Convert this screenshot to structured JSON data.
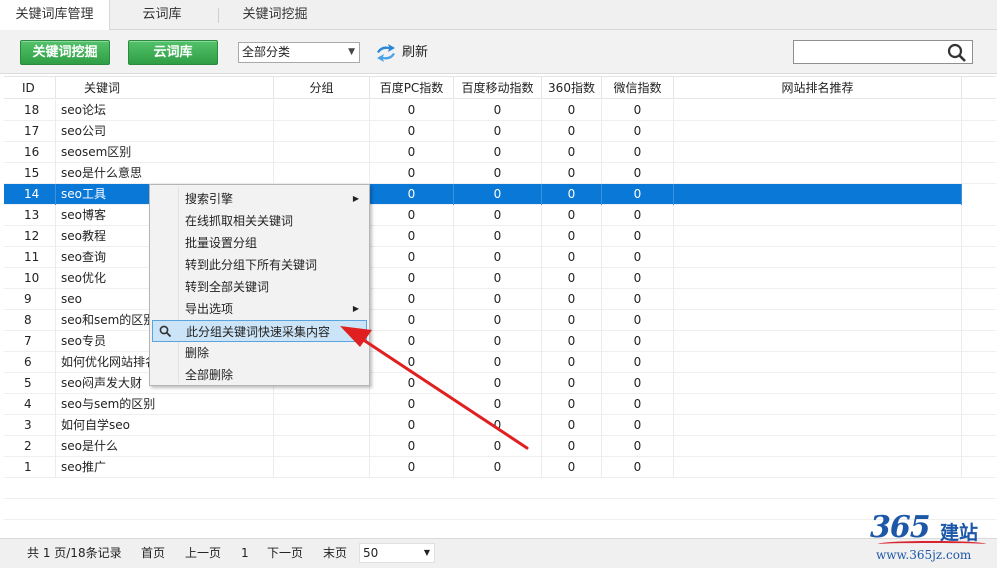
{
  "tabs": [
    {
      "label": "关键词库管理"
    },
    {
      "label": "云词库"
    },
    {
      "label": "关键词挖掘"
    }
  ],
  "toolbar": {
    "mine_button": "关键词挖掘",
    "cloud_button": "云词库",
    "category_select": "全部分类",
    "refresh_label": "刷新",
    "search_value": ""
  },
  "columns": {
    "id": "ID",
    "keyword": "关键词",
    "group": "分组",
    "baidu_pc": "百度PC指数",
    "baidu_mobile": "百度移动指数",
    "s360": "360指数",
    "wechat": "微信指数",
    "rank": "网站排名推荐"
  },
  "rows": [
    {
      "id": "18",
      "keyword": "seo论坛",
      "pc": "0",
      "mobile": "0",
      "s360": "0",
      "wechat": "0"
    },
    {
      "id": "17",
      "keyword": "seo公司",
      "pc": "0",
      "mobile": "0",
      "s360": "0",
      "wechat": "0"
    },
    {
      "id": "16",
      "keyword": "seosem区别",
      "pc": "0",
      "mobile": "0",
      "s360": "0",
      "wechat": "0"
    },
    {
      "id": "15",
      "keyword": "seo是什么意思",
      "pc": "0",
      "mobile": "0",
      "s360": "0",
      "wechat": "0"
    },
    {
      "id": "14",
      "keyword": "seo工具",
      "pc": "0",
      "mobile": "0",
      "s360": "0",
      "wechat": "0"
    },
    {
      "id": "13",
      "keyword": "seo博客",
      "pc": "0",
      "mobile": "0",
      "s360": "0",
      "wechat": "0"
    },
    {
      "id": "12",
      "keyword": "seo教程",
      "pc": "0",
      "mobile": "0",
      "s360": "0",
      "wechat": "0"
    },
    {
      "id": "11",
      "keyword": "seo查询",
      "pc": "0",
      "mobile": "0",
      "s360": "0",
      "wechat": "0"
    },
    {
      "id": "10",
      "keyword": "seo优化",
      "pc": "0",
      "mobile": "0",
      "s360": "0",
      "wechat": "0"
    },
    {
      "id": "9",
      "keyword": "seo",
      "pc": "0",
      "mobile": "0",
      "s360": "0",
      "wechat": "0"
    },
    {
      "id": "8",
      "keyword": "seo和sem的区别",
      "pc": "0",
      "mobile": "0",
      "s360": "0",
      "wechat": "0"
    },
    {
      "id": "7",
      "keyword": "seo专员",
      "pc": "0",
      "mobile": "0",
      "s360": "0",
      "wechat": "0"
    },
    {
      "id": "6",
      "keyword": "如何优化网站排名",
      "pc": "0",
      "mobile": "0",
      "s360": "0",
      "wechat": "0"
    },
    {
      "id": "5",
      "keyword": "seo闷声发大财",
      "pc": "0",
      "mobile": "0",
      "s360": "0",
      "wechat": "0"
    },
    {
      "id": "4",
      "keyword": "seo与sem的区别",
      "pc": "0",
      "mobile": "0",
      "s360": "0",
      "wechat": "0"
    },
    {
      "id": "3",
      "keyword": "如何自学seo",
      "pc": "0",
      "mobile": "0",
      "s360": "0",
      "wechat": "0"
    },
    {
      "id": "2",
      "keyword": "seo是什么",
      "pc": "0",
      "mobile": "0",
      "s360": "0",
      "wechat": "0"
    },
    {
      "id": "1",
      "keyword": "seo推广",
      "pc": "0",
      "mobile": "0",
      "s360": "0",
      "wechat": "0"
    }
  ],
  "selected_row_id": "14",
  "context_menu": [
    {
      "label": "搜索引擎",
      "submenu": true
    },
    {
      "label": "在线抓取相关关键词",
      "submenu": false
    },
    {
      "label": "批量设置分组",
      "submenu": false
    },
    {
      "label": "转到此分组下所有关键词",
      "submenu": false
    },
    {
      "label": "转到全部关键词",
      "submenu": false
    },
    {
      "label": "导出选项",
      "submenu": true
    },
    {
      "label": "此分组关键词快速采集内容",
      "submenu": false,
      "highlighted": true,
      "icon": "search-icon"
    },
    {
      "label": "删除",
      "submenu": false
    },
    {
      "label": "全部删除",
      "submenu": false
    }
  ],
  "footer": {
    "summary": "共 1 页/18条记录",
    "first": "首页",
    "prev": "上一页",
    "page": "1",
    "next": "下一页",
    "last": "末页",
    "page_size": "50"
  },
  "watermark": {
    "logo": "365建站",
    "url": "www.365jz.com"
  },
  "colors": {
    "accent_green": "#2f9e45",
    "selection_blue": "#0a78d7",
    "annotation_red": "#e02020",
    "watermark_blue": "#1d58a8"
  }
}
